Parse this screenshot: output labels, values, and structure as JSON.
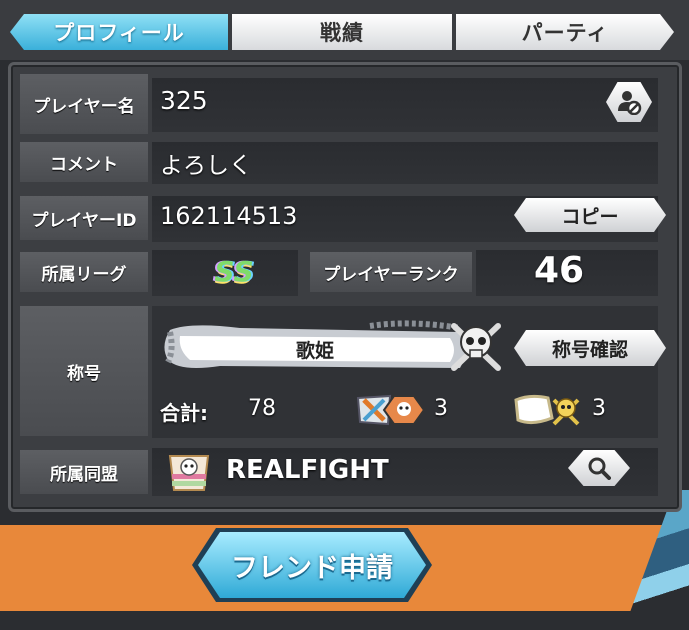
{
  "tabs": [
    {
      "label": "プロフィール",
      "active": true
    },
    {
      "label": "戦績",
      "active": false
    },
    {
      "label": "パーティ",
      "active": false
    }
  ],
  "profile": {
    "player_name_label": "プレイヤー名",
    "player_name": "325",
    "comment_label": "コメント",
    "comment": "よろしく",
    "player_id_label": "プレイヤーID",
    "player_id": "162114513",
    "copy_button": "コピー",
    "league_label": "所属リーグ",
    "league_value": "SS",
    "rank_label": "プレイヤーランク",
    "rank_value": "46",
    "title_label": "称号",
    "title_value": "歌姫",
    "title_confirm_button": "称号確認",
    "total_label": "合計:",
    "total_value": "78",
    "badge_count_1": "3",
    "badge_count_2": "3",
    "alliance_label": "所属同盟",
    "alliance_name": "REALFIGHT"
  },
  "friend_request_button": "フレンド申請",
  "colors": {
    "accent_blue": "#3ab0da",
    "background_orange": "#e8883a",
    "panel": "#3c3e42"
  },
  "icons": [
    "block-user-icon",
    "search-icon",
    "skull-crossbones-icon",
    "alliance-flag-icon",
    "league-ss-icon"
  ]
}
